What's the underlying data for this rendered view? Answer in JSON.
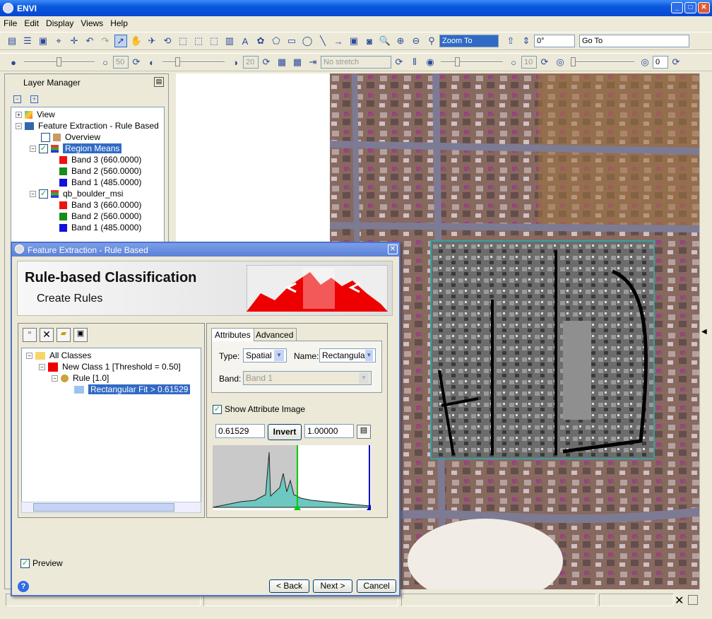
{
  "app": {
    "title": "ENVI"
  },
  "menu": [
    "File",
    "Edit",
    "Display",
    "Views",
    "Help"
  ],
  "toolbar": {
    "zoom_select": "Zoom To",
    "rotation": "0°",
    "goto_placeholder": "Go To",
    "brightness": "50",
    "contrast": "20",
    "stretch": "No stretch",
    "sharpen": "10",
    "transparency": "0"
  },
  "layer_manager": {
    "title": "Layer Manager",
    "items": [
      {
        "label": "View"
      },
      {
        "label": "Feature Extraction - Rule Based"
      },
      {
        "label": "Overview"
      },
      {
        "label": "Region Means"
      },
      {
        "label": "Band 3 (660.0000)",
        "color": "#ee1111"
      },
      {
        "label": "Band 2 (560.0000)",
        "color": "#1a8a1a"
      },
      {
        "label": "Band 1 (485.0000)",
        "color": "#1111dd"
      },
      {
        "label": "qb_boulder_msi"
      },
      {
        "label": "Band 3 (660.0000)",
        "color": "#ee1111"
      },
      {
        "label": "Band 2 (560.0000)",
        "color": "#1a8a1a"
      },
      {
        "label": "Band 1 (485.0000)",
        "color": "#1111dd"
      }
    ]
  },
  "dialog": {
    "title": "Feature Extraction - Rule Based",
    "heading": "Rule-based Classification",
    "subheading": "Create Rules",
    "tree": {
      "root": "All Classes",
      "class": "New Class 1 [Threshold = 0.50]",
      "rule": "Rule [1.0]",
      "attribute": "Rectangular Fit > 0.61529"
    },
    "tabs": {
      "attributes": "Attributes",
      "advanced": "Advanced"
    },
    "type_label": "Type:",
    "type_value": "Spatial",
    "name_label": "Name:",
    "name_value": "Rectangula",
    "band_label": "Band:",
    "band_value": "Band 1",
    "show_attr_image": "Show Attribute Image",
    "min_value": "0.61529",
    "invert_label": "Invert",
    "max_value": "1.00000",
    "preview_label": "Preview",
    "back_label": "< Back",
    "next_label": "Next >",
    "cancel_label": "Cancel"
  },
  "colors": {
    "accent": "#316ac5",
    "class_color": "#ee0000"
  }
}
